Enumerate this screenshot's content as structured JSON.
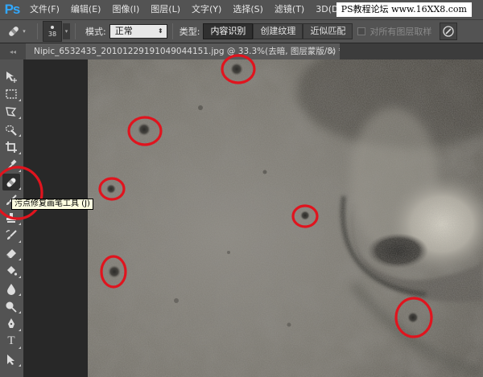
{
  "app": {
    "logo": "Ps",
    "menu": [
      "文件(F)",
      "编辑(E)",
      "图像(I)",
      "图层(L)",
      "文字(Y)",
      "选择(S)",
      "滤镜(T)",
      "3D(D)"
    ],
    "watermark": "PS教程论坛 www.16XX8.com"
  },
  "options": {
    "brush_size": "38",
    "mode_label": "模式:",
    "mode_value": "正常",
    "type_label": "类型:",
    "type_buttons": [
      "内容识别",
      "创建纹理",
      "近似匹配"
    ],
    "type_selected": "内容识别",
    "sample_all_layers": "对所有图层取样"
  },
  "document": {
    "tab_title": "Nipic_6532435_20101229191049044151.jpg @ 33.3%(去暗, 图层蒙版/8) *",
    "close_glyph": "×"
  },
  "toolbar": {
    "tools": [
      "move-tool",
      "marquee-tool",
      "lasso-tool",
      "quick-selection-tool",
      "crop-tool",
      "eyedropper-tool",
      "spot-healing-brush-tool",
      "brush-tool",
      "clone-stamp-tool",
      "history-brush-tool",
      "eraser-tool",
      "paint-bucket-tool",
      "blur-tool",
      "dodge-tool",
      "pen-tool",
      "type-tool",
      "path-selection-tool"
    ],
    "active_tool": "spot-healing-brush-tool",
    "type_tool_glyph": "T",
    "tooltip": "污点修复画笔工具 (J)"
  },
  "annotations": {
    "marker_color": "#e0141e",
    "marker_count": 8
  },
  "colors": {
    "ui_panel": "#535353",
    "ps_blue": "#31a8ff"
  }
}
